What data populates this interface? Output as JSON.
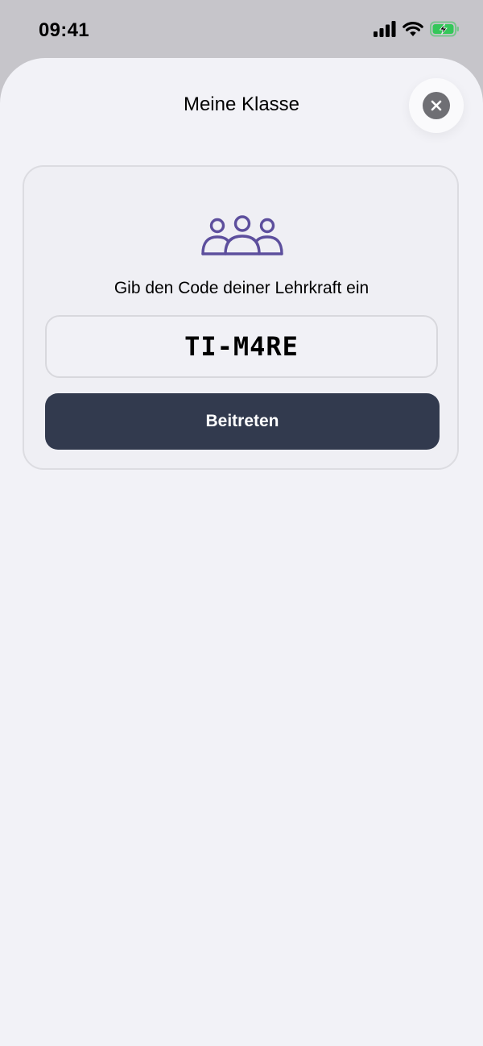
{
  "status_bar": {
    "time": "09:41",
    "icons": [
      "signal-icon",
      "wifi-icon",
      "battery-charging-icon"
    ],
    "battery_color": "#34c759"
  },
  "sheet": {
    "title": "Meine Klasse",
    "close_icon": "close-icon"
  },
  "join_card": {
    "icon": "group-icon",
    "icon_color": "#5d4f9d",
    "prompt": "Gib den Code deiner Lehrkraft ein",
    "code_value": "TI-M4RE",
    "join_label": "Beitreten",
    "button_color": "#323a4e"
  }
}
